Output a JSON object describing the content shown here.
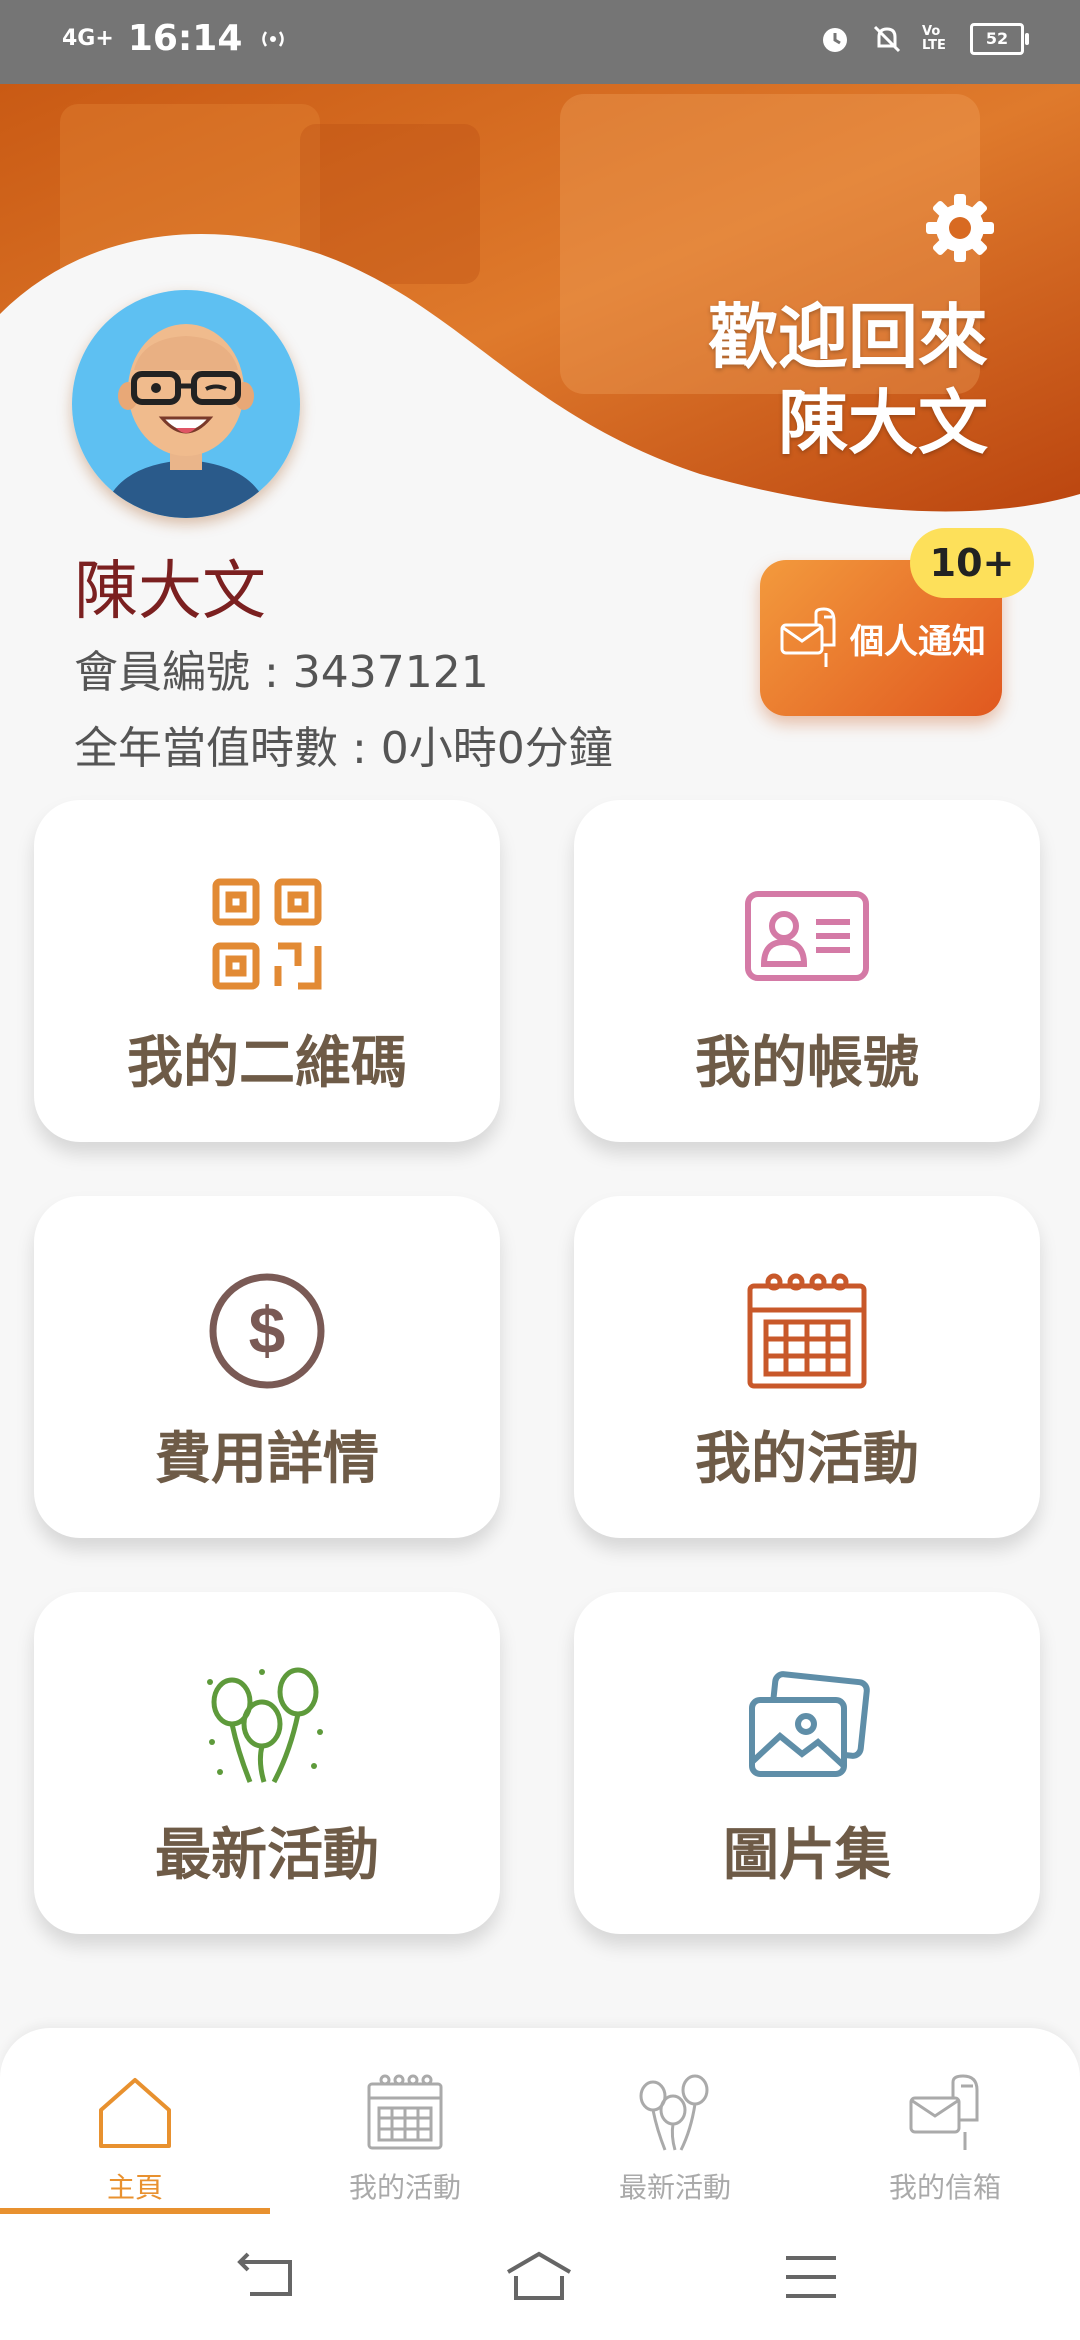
{
  "status_bar": {
    "network": "4G+",
    "time": "16:14",
    "volte": "Vo LTE",
    "battery": "52"
  },
  "header": {
    "welcome_line1": "歡迎回來",
    "welcome_line2": "陳大文"
  },
  "profile": {
    "name": "陳大文",
    "member_no": "會員編號 : 3437121",
    "service_hours": "全年當值時數 : 0小時0分鐘"
  },
  "notification": {
    "label": "個人通知",
    "badge": "10+"
  },
  "menu": [
    {
      "label": "我的二維碼",
      "icon": "qr-code-icon",
      "color": "#e28a34"
    },
    {
      "label": "我的帳號",
      "icon": "id-card-icon",
      "color": "#d47aa6"
    },
    {
      "label": "費用詳情",
      "icon": "dollar-icon",
      "color": "#7a5a55"
    },
    {
      "label": "我的活動",
      "icon": "calendar-icon",
      "color": "#c8582a"
    },
    {
      "label": "最新活動",
      "icon": "balloons-icon",
      "color": "#5e9a3b"
    },
    {
      "label": "圖片集",
      "icon": "gallery-icon",
      "color": "#5f8ea8"
    }
  ],
  "bottom_nav": [
    {
      "label": "主頁",
      "icon": "home-icon",
      "active": true
    },
    {
      "label": "我的活動",
      "icon": "calendar-icon",
      "active": false
    },
    {
      "label": "最新活動",
      "icon": "balloons-icon",
      "active": false
    },
    {
      "label": "我的信箱",
      "icon": "mailbox-icon",
      "active": false
    }
  ],
  "colors": {
    "accent": "#e8912f",
    "header_orange": "#d45c14",
    "name_color": "#7b2020",
    "card_text": "#6e5b47"
  }
}
